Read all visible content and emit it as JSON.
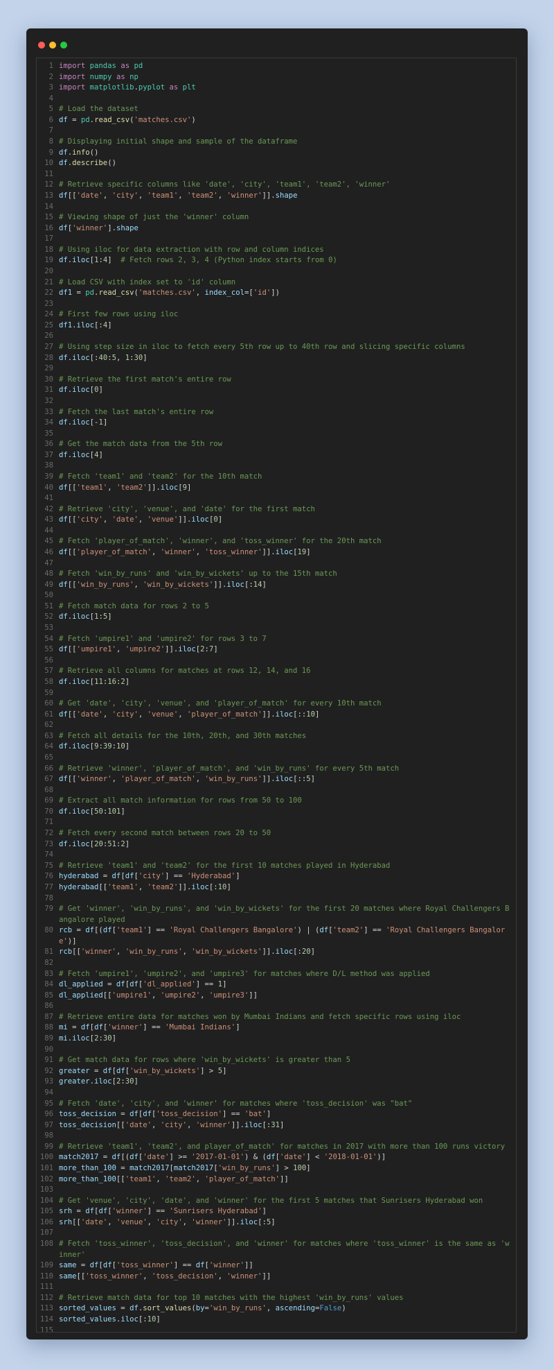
{
  "window": {
    "controls": [
      "close",
      "minimize",
      "maximize"
    ]
  },
  "colors": {
    "background": "#c2d3ea",
    "window": "#202020",
    "keyword": "#c586c0",
    "module": "#4ec9b0",
    "string": "#ce9178",
    "comment": "#6a9955",
    "identifier": "#9cdcfe",
    "function": "#dcdcaa",
    "number": "#b5cea8",
    "constant": "#569cd6"
  },
  "code_lines": [
    "import pandas as pd",
    "import numpy as np",
    "import matplotlib.pyplot as plt",
    "",
    "# Load the dataset",
    "df = pd.read_csv('matches.csv')",
    "",
    "# Displaying initial shape and sample of the dataframe",
    "df.info()",
    "df.describe()",
    "",
    "# Retrieve specific columns like 'date', 'city', 'team1', 'team2', 'winner'",
    "df[['date', 'city', 'team1', 'team2', 'winner']].shape",
    "",
    "# Viewing shape of just the 'winner' column",
    "df['winner'].shape",
    "",
    "# Using iloc for data extraction with row and column indices",
    "df.iloc[1:4]  # Fetch rows 2, 3, 4 (Python index starts from 0)",
    "",
    "# Load CSV with index set to 'id' column",
    "df1 = pd.read_csv('matches.csv', index_col=['id'])",
    "",
    "# First few rows using iloc",
    "df1.iloc[:4]",
    "",
    "# Using step size in iloc to fetch every 5th row up to 40th row and slicing specific columns",
    "df.iloc[:40:5, 1:30]",
    "",
    "# Retrieve the first match's entire row",
    "df.iloc[0]",
    "",
    "# Fetch the last match's entire row",
    "df.iloc[-1]",
    "",
    "# Get the match data from the 5th row",
    "df.iloc[4]",
    "",
    "# Fetch 'team1' and 'team2' for the 10th match",
    "df[['team1', 'team2']].iloc[9]",
    "",
    "# Retrieve 'city', 'venue', and 'date' for the first match",
    "df[['city', 'date', 'venue']].iloc[0]",
    "",
    "# Fetch 'player_of_match', 'winner', and 'toss_winner' for the 20th match",
    "df[['player_of_match', 'winner', 'toss_winner']].iloc[19]",
    "",
    "# Fetch 'win_by_runs' and 'win_by_wickets' up to the 15th match",
    "df[['win_by_runs', 'win_by_wickets']].iloc[:14]",
    "",
    "# Fetch match data for rows 2 to 5",
    "df.iloc[1:5]",
    "",
    "# Fetch 'umpire1' and 'umpire2' for rows 3 to 7",
    "df[['umpire1', 'umpire2']].iloc[2:7]",
    "",
    "# Retrieve all columns for matches at rows 12, 14, and 16",
    "df.iloc[11:16:2]",
    "",
    "# Get 'date', 'city', 'venue', and 'player_of_match' for every 10th match",
    "df[['date', 'city', 'venue', 'player_of_match']].iloc[::10]",
    "",
    "# Fetch all details for the 10th, 20th, and 30th matches",
    "df.iloc[9:39:10]",
    "",
    "# Retrieve 'winner', 'player_of_match', and 'win_by_runs' for every 5th match",
    "df[['winner', 'player_of_match', 'win_by_runs']].iloc[::5]",
    "",
    "# Extract all match information for rows from 50 to 100",
    "df.iloc[50:101]",
    "",
    "# Fetch every second match between rows 20 to 50",
    "df.iloc[20:51:2]",
    "",
    "# Retrieve 'team1' and 'team2' for the first 10 matches played in Hyderabad",
    "hyderabad = df[df['city'] == 'Hyderabad']",
    "hyderabad[['team1', 'team2']].iloc[:10]",
    "",
    "# Get 'winner', 'win_by_runs', and 'win_by_wickets' for the first 20 matches where Royal Challengers Bangalore played",
    "rcb = df[(df['team1'] == 'Royal Challengers Bangalore') | (df['team2'] == 'Royal Challengers Bangalore')]",
    "rcb[['winner', 'win_by_runs', 'win_by_wickets']].iloc[:20]",
    "",
    "# Fetch 'umpire1', 'umpire2', and 'umpire3' for matches where D/L method was applied",
    "dl_applied = df[df['dl_applied'] == 1]",
    "dl_applied[['umpire1', 'umpire2', 'umpire3']]",
    "",
    "# Retrieve entire data for matches won by Mumbai Indians and fetch specific rows using iloc",
    "mi = df[df['winner'] == 'Mumbai Indians']",
    "mi.iloc[2:30]",
    "",
    "# Get match data for rows where 'win_by_wickets' is greater than 5",
    "greater = df[df['win_by_wickets'] > 5]",
    "greater.iloc[2:30]",
    "",
    "# Fetch 'date', 'city', and 'winner' for matches where 'toss_decision' was \"bat\"",
    "toss_decision = df[df['toss_decision'] == 'bat']",
    "toss_decision[['date', 'city', 'winner']].iloc[:31]",
    "",
    "# Retrieve 'team1', 'team2', and player_of_match' for matches in 2017 with more than 100 runs victory",
    "match2017 = df[(df['date'] >= '2017-01-01') & (df['date'] < '2018-01-01')]",
    "more_than_100 = match2017[match2017['win_by_runs'] > 100]",
    "more_than_100[['team1', 'team2', 'player_of_match']]",
    "",
    "# Get 'venue', 'city', 'date', and 'winner' for the first 5 matches that Sunrisers Hyderabad won",
    "srh = df[df['winner'] == 'Sunrisers Hyderabad']",
    "srh[['date', 'venue', 'city', 'winner']].iloc[:5]",
    "",
    "# Fetch 'toss_winner', 'toss_decision', and 'winner' for matches where 'toss_winner' is the same as 'winner'",
    "same = df[df['toss_winner'] == df['winner']]",
    "same[['toss_winner', 'toss_decision', 'winner']]",
    "",
    "# Retrieve match data for top 10 matches with the highest 'win_by_runs' values",
    "sorted_values = df.sort_values(by='win_by_runs', ascending=False)",
    "sorted_values.iloc[:10]",
    ""
  ]
}
